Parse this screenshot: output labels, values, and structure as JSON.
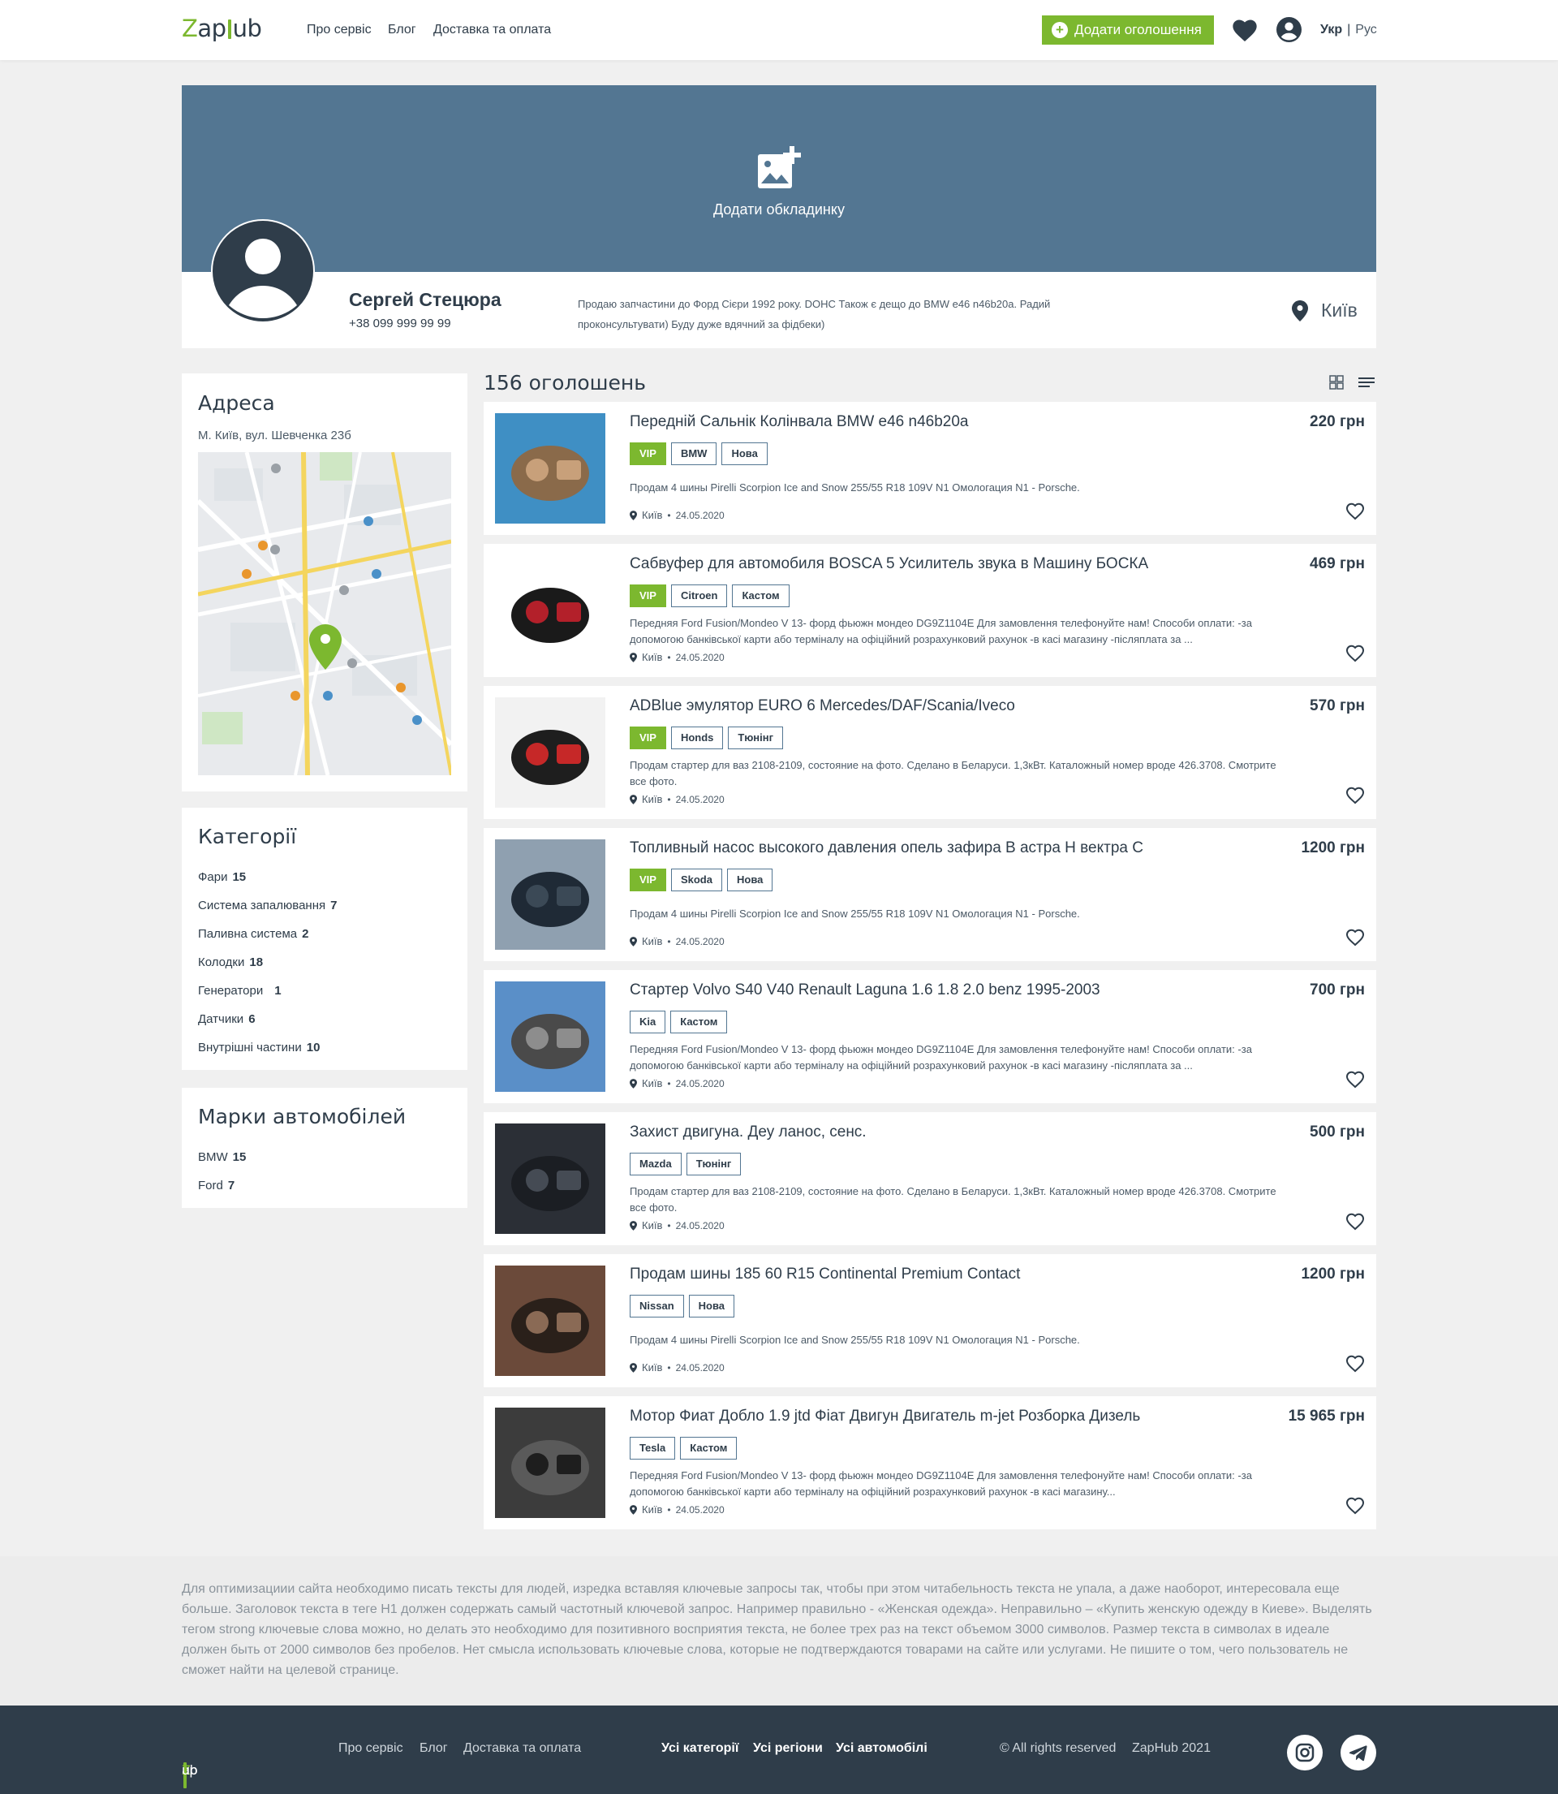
{
  "header": {
    "logo": {
      "z": "Z",
      "ap": "ap",
      "ub": "ub"
    },
    "nav": [
      "Про сервіс",
      "Блог",
      "Доставка та оплата"
    ],
    "add_button": "Додати оголошення",
    "lang_active": "Укр",
    "lang_sep": "|",
    "lang_other": "Рус"
  },
  "profile": {
    "cover_label": "Додати обкладинку",
    "name": "Сергей Стецюра",
    "phone": "+38 099 999 99 99",
    "description": "Продаю запчастини до Форд Сієри 1992 року. DOHC Також є дещо до BMW e46 n46b20a. Радий проконсультувати) Буду дуже вдячний за фідбеки)",
    "city": "Київ"
  },
  "sidebar": {
    "address_title": "Адреса",
    "address": "М. Київ, вул. Шевченка 23б",
    "categories_title": "Категорії",
    "categories": [
      {
        "name": "Фари",
        "count": "15"
      },
      {
        "name": "Система запалювання",
        "count": "7"
      },
      {
        "name": "Паливна система",
        "count": "2"
      },
      {
        "name": "Колодки",
        "count": "18"
      },
      {
        "name": "Генератори",
        "count": "1"
      },
      {
        "name": "Датчики",
        "count": "6"
      },
      {
        "name": "Внутрішні частини",
        "count": "10"
      }
    ],
    "brands_title": "Марки автомобілей",
    "brands": [
      {
        "name": "BMW",
        "count": "15"
      },
      {
        "name": "Ford",
        "count": "7"
      }
    ]
  },
  "listings_count": "156 оголошень",
  "listings": [
    {
      "title": "Передній Сальнік Колінвала BMW e46 n46b20a",
      "price": "220 грн",
      "tags": [
        "VIP",
        "BMW",
        "Нова"
      ],
      "desc": "Продам 4 шины Pirelli Scorpion Ice and Snow 255/55 R18 109V N1 Омологация N1 - Porsche.",
      "city": "Київ",
      "date": "24.05.2020"
    },
    {
      "title": "Сабвуфер для автомобиля BOSCA 5 Усилитель звука в Машину БОСКА",
      "price": "469 грн",
      "tags": [
        "VIP",
        "Citroen",
        "Кастом"
      ],
      "desc": "Передняя Ford Fusion/Mondeo V 13- форд фьюжн мондео DG9Z1104E Для замовлення телефонуйте нам! Способи оплати: -за допомогою банківської карти або терміналу на офіційний розрахунковий рахунок -в касі магазину -післяплата за ...",
      "city": "Київ",
      "date": "24.05.2020"
    },
    {
      "title": "ADBlue эмулятор EURO 6 Mercedes/DAF/Scania/Iveco",
      "price": "570 грн",
      "tags": [
        "VIP",
        "Honds",
        "Тюнінг"
      ],
      "desc": "Продам стартер для ваз 2108-2109, состояние на фото. Сделано в Беларуси. 1,3кВт. Каталожный номер вроде 426.3708. Смотрите все фото.",
      "city": "Київ",
      "date": "24.05.2020"
    },
    {
      "title": "Топливный насос высокого давления опель зафира В астра Н вектра С",
      "price": "1200 грн",
      "tags": [
        "VIP",
        "Skoda",
        "Нова"
      ],
      "desc": "Продам 4 шины Pirelli Scorpion Ice and Snow 255/55 R18 109V N1 Омологация N1 - Porsche.",
      "city": "Київ",
      "date": "24.05.2020"
    },
    {
      "title": "Стартер Volvo S40 V40 Renault Laguna 1.6 1.8 2.0 benz 1995-2003",
      "price": "700 грн",
      "tags": [
        "Kia",
        "Кастом"
      ],
      "desc": "Передняя Ford Fusion/Mondeo V 13- форд фьюжн мондео DG9Z1104E Для замовлення телефонуйте нам! Способи оплати: -за допомогою банківської карти або терміналу на офіційний розрахунковий рахунок -в касі магазину -післяплата за ...",
      "city": "Київ",
      "date": "24.05.2020"
    },
    {
      "title": "Захист двигуна. Деу ланос, сенс.",
      "price": "500 грн",
      "tags": [
        "Mazda",
        "Тюнінг"
      ],
      "desc": "Продам стартер для ваз 2108-2109, состояние на фото. Сделано в Беларуси. 1,3кВт. Каталожный номер вроде 426.3708. Смотрите все фото.",
      "city": "Київ",
      "date": "24.05.2020"
    },
    {
      "title": "Продам шины 185 60 R15 Continental Premium Contact",
      "price": "1200 грн",
      "tags": [
        "Nissan",
        "Нова"
      ],
      "desc": "Продам 4 шины Pirelli Scorpion Ice and Snow 255/55 R18 109V N1 Омологация N1 - Porsche.",
      "city": "Київ",
      "date": "24.05.2020"
    },
    {
      "title": "Мотор Фиат Добло 1.9 jtd Фіат Двигун Двигатель m-jet Розборка Дизель",
      "price": "15 965 грн",
      "tags": [
        "Tesla",
        "Кастом"
      ],
      "desc": "Передняя Ford Fusion/Mondeo V 13- форд фьюжн мондео DG9Z1104E Для замовлення телефонуйте нам! Способи оплати: -за допомогою банківської карти або терміналу на офіційний розрахунковий рахунок -в касі магазину...",
      "city": "Київ",
      "date": "24.05.2020"
    }
  ],
  "seo_text": "Для оптимизациии сайта необходимо писать тексты для людей, изредка вставляя ключевые запросы так, чтобы при этом читабельность текста не упала, а даже наоборот, интересовала еще больше. Заголовок текста в теге H1 должен содержать самый частотный ключевой запрос. Например правильно - «Женская одежда». Неправильно – «Купить женскую одежду в Киеве». Выделять тегом strong ключевые слова можно, но делать это необходимо для позитивного восприятия текста, не более трех раз на текст объемом 3000 символов. Размер текста в символах в идеале должен быть от 2000 символов без пробелов. Нет смысла использовать ключевые слова, которые не подтверждаются товарами на сайте или услугами. Не пишите о том, чего пользователь не сможет найти на целевой странице.",
  "footer": {
    "nav": [
      "Про сервіс",
      "Блог",
      "Доставка та оплата"
    ],
    "links": [
      "Усі категорії",
      "Усі регіони",
      "Усі автомобілі"
    ],
    "rights": "© All rights reserved",
    "brand_year": "ZapHub 2021"
  },
  "icons": {
    "favorite": "heart-icon",
    "account": "user-icon",
    "location": "map-pin-icon",
    "grid_view": "grid-icon",
    "list_view": "list-icon",
    "instagram": "instagram-icon",
    "telegram": "telegram-icon"
  },
  "colors": {
    "accent": "#7cb82f",
    "dark": "#2f3d4a",
    "cover": "#537692"
  }
}
